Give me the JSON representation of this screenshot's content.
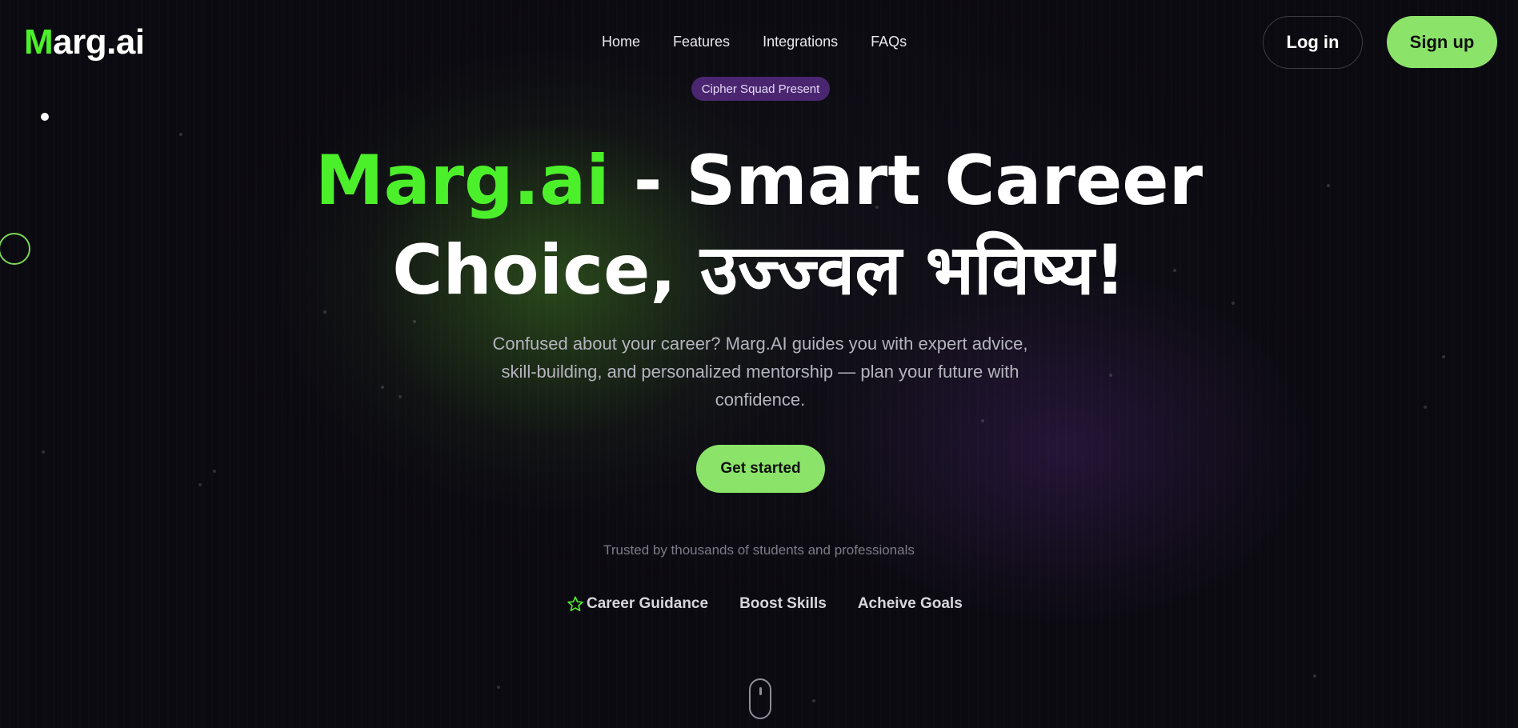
{
  "brand": {
    "logo_accent": "M",
    "logo_rest": "arg.ai",
    "accent_color": "#4cf02a",
    "button_color": "#8be36a"
  },
  "nav": {
    "items": [
      {
        "label": "Home"
      },
      {
        "label": "Features"
      },
      {
        "label": "Integrations"
      },
      {
        "label": "FAQs"
      }
    ],
    "login_label": "Log in",
    "signup_label": "Sign up"
  },
  "hero": {
    "badge": "Cipher Squad Present",
    "title_brand": "Marg.ai",
    "title_line1_rest": " - Smart Career",
    "title_line2": "Choice, उज्ज्वल भविष्य!",
    "subtitle": "Confused about your career? Marg.AI guides you with expert advice, skill-building, and personalized mentorship — plan your future with confidence.",
    "cta_label": "Get started",
    "trusted_text": "Trusted by thousands of students and professionals",
    "features": [
      {
        "label": "Career Guidance",
        "icon": "star-outline-icon"
      },
      {
        "label": "Boost Skills"
      },
      {
        "label": "Acheive Goals"
      }
    ]
  },
  "decor": {
    "scroll_indicator_icon": "mouse-scroll-icon",
    "ring_icon": "circle-outline-icon"
  }
}
